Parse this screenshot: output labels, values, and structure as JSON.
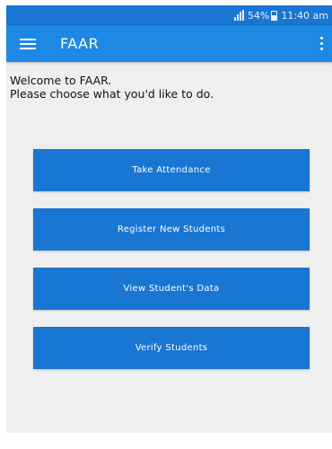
{
  "status_bar": {
    "battery": "54%",
    "time": "11:40 am"
  },
  "app_bar": {
    "title": "FAAR",
    "menu_icon": "hamburger-menu-icon",
    "overflow_icon": "more-vert-icon"
  },
  "welcome": {
    "line1": "Welcome to FAAR.",
    "line2": "Please choose what you'd like to do."
  },
  "actions": {
    "take_attendance": "Take Attendance",
    "register_students": "Register New Students",
    "view_data": "View Student's Data",
    "verify_students": "Verify Students"
  },
  "colors": {
    "status_bar": "#1976d2",
    "app_bar": "#1e88e5",
    "button": "#1976d2",
    "background": "#efefef"
  }
}
